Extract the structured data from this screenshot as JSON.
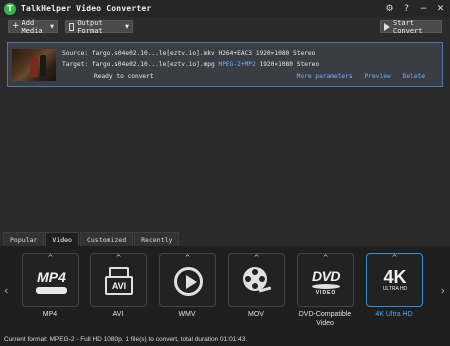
{
  "window": {
    "title": "TalkHelper Video Converter",
    "logo_letter": "T",
    "settings_glyph": "⚙",
    "help_glyph": "?",
    "minimize_glyph": "−",
    "close_glyph": "✕"
  },
  "toolbar": {
    "add_media_label": "Add Media",
    "output_format_label": "Output Format",
    "start_convert_label": "Start Convert"
  },
  "file_item": {
    "source_label": "Source:",
    "source_name": "fargo.s04e02.10...le[eztv.io].mkv",
    "source_info": "H264+EAC3 1920×1080 Stereo",
    "target_label": "Target:",
    "target_name": "fargo.s04e02.10...le[eztv.io].mpg",
    "target_codec": "MPEG-2+MP2",
    "target_info": "1920×1080 Stereo",
    "status": "Ready to convert",
    "more_parameters": "More parameters",
    "preview": "Preview",
    "delete": "Delete"
  },
  "tabs": [
    {
      "label": "Popular",
      "active": false
    },
    {
      "label": "Video",
      "active": true
    },
    {
      "label": "Customized",
      "active": false
    },
    {
      "label": "Recently",
      "active": false
    }
  ],
  "formats": [
    {
      "label": "MP4",
      "icon": "mp4-icon",
      "icon_text": "MP4",
      "selected": false
    },
    {
      "label": "AVI",
      "icon": "avi-icon",
      "icon_text": "AVI",
      "selected": false
    },
    {
      "label": "WMV",
      "icon": "wmv-icon",
      "selected": false
    },
    {
      "label": "MOV",
      "icon": "film-reel-icon",
      "selected": false
    },
    {
      "label": "DVD-Compatible Video",
      "icon": "dvd-icon",
      "icon_text": "DVD",
      "icon_subtext": "VIDEO",
      "selected": false
    },
    {
      "label": "4K Ultra HD",
      "icon": "4k-icon",
      "icon_text": "4K",
      "icon_subtext": "ULTRA HD",
      "selected": true
    }
  ],
  "status_bar": "Current format: MPEG-2 - Full HD 1080p. 1 file(s) to convert, total duration 01:01:43.",
  "colors": {
    "accent": "#4aa6ff",
    "logo": "#35b54a",
    "background": "#2b2b2b"
  }
}
